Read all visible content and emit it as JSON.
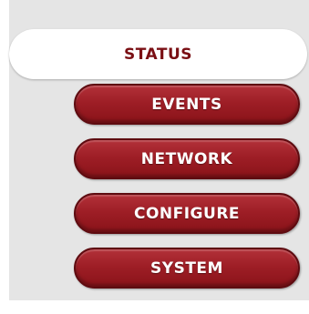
{
  "nav": {
    "status_label": "STATUS",
    "events_label": "EVENTS",
    "network_label": "NETWORK",
    "configure_label": "CONFIGURE",
    "system_label": "SYSTEM"
  },
  "colors": {
    "panel_background": "#e5e5e5",
    "button_red": "#9e1e26",
    "button_border": "#5e0b10",
    "active_tab_background": "#ffffff",
    "active_tab_text": "#7a0f14"
  }
}
